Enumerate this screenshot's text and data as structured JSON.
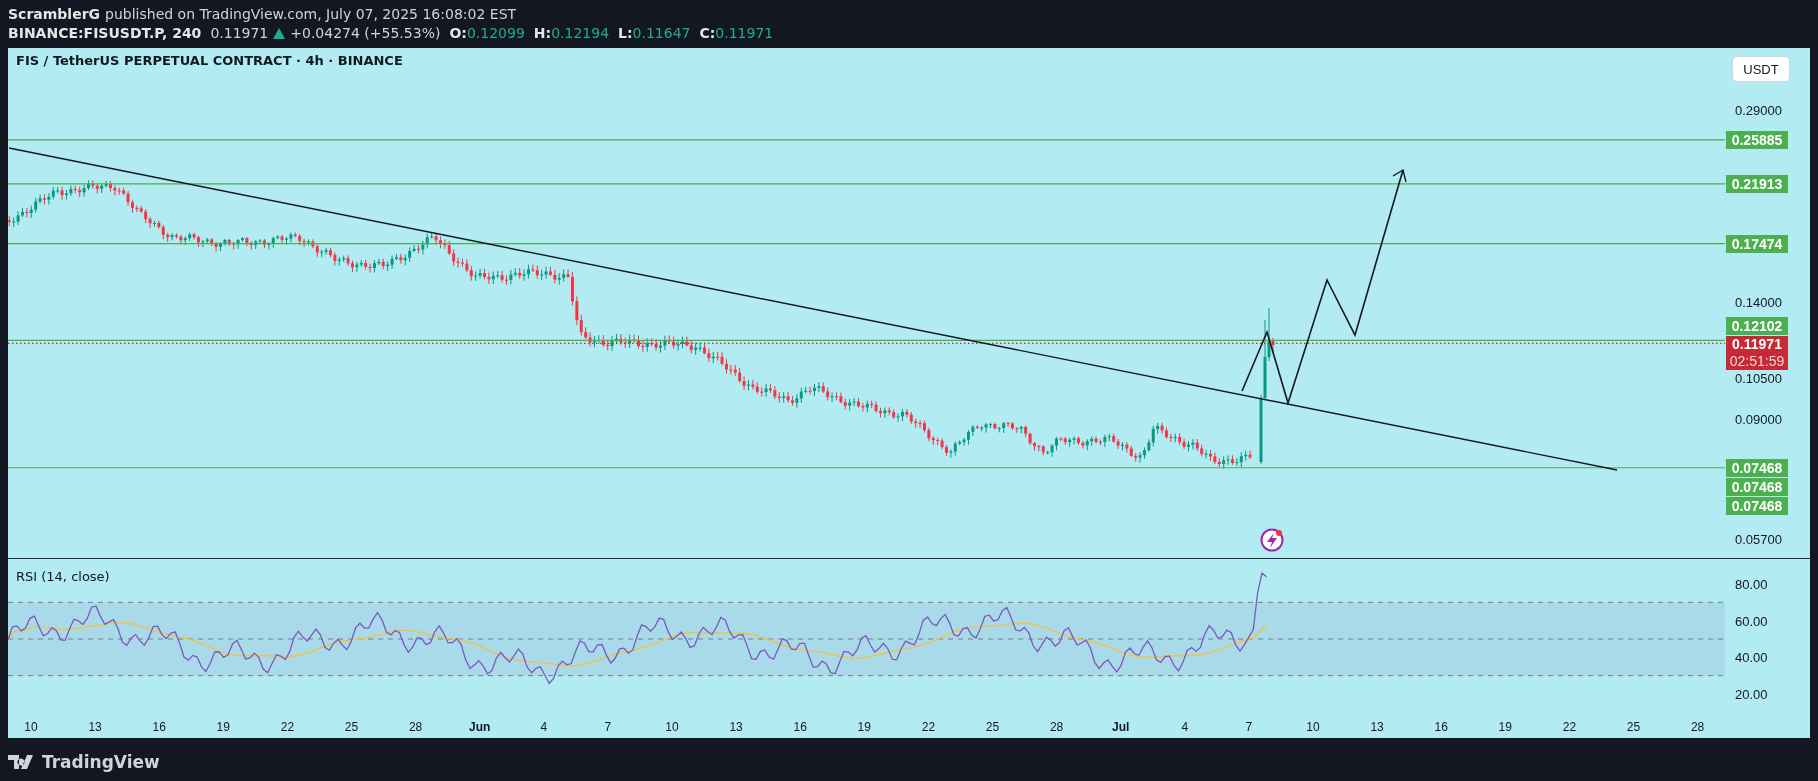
{
  "header": {
    "author": "ScramblerG",
    "published": "published on TradingView.com, July 07, 2025 16:08:02 EST"
  },
  "quote": {
    "symbol": "BINANCE:FISUSDT.P, 240",
    "last": "0.11971",
    "rising": true,
    "change": "+0.04274 (+55.53%)",
    "ohlc": [
      {
        "label": "O:",
        "value": "0.12099"
      },
      {
        "label": "H:",
        "value": "0.12194"
      },
      {
        "label": "L:",
        "value": "0.11647"
      },
      {
        "label": "C:",
        "value": "0.11971"
      }
    ]
  },
  "chart": {
    "title": "FIS / TetherUS PERPETUAL CONTRACT · 4h · BINANCE",
    "currency": "USDT",
    "price_ticks": [
      "0.29000",
      "0.14000",
      "0.10500",
      "0.09000",
      "0.05700"
    ],
    "levels": [
      {
        "price": "0.25885",
        "kind": "line"
      },
      {
        "price": "0.21913",
        "kind": "line"
      },
      {
        "price": "0.17474",
        "kind": "line"
      },
      {
        "price": "0.12102",
        "kind": "line"
      },
      {
        "price": "0.11971",
        "kind": "last",
        "countdown": "02:51:59"
      },
      {
        "price": "0.07468",
        "kind": "line"
      },
      {
        "price": "0.07468",
        "kind": "stack"
      },
      {
        "price": "0.07468",
        "kind": "stack"
      }
    ],
    "rsi": {
      "title": "RSI (14, close)",
      "ticks": [
        "80.00",
        "60.00",
        "40.00",
        "20.00"
      ]
    },
    "time_axis": [
      {
        "label": "10",
        "kind": "day"
      },
      {
        "label": "13",
        "kind": "day"
      },
      {
        "label": "16",
        "kind": "day"
      },
      {
        "label": "19",
        "kind": "day"
      },
      {
        "label": "22",
        "kind": "day"
      },
      {
        "label": "25",
        "kind": "day"
      },
      {
        "label": "28",
        "kind": "day"
      },
      {
        "label": "Jun",
        "kind": "month"
      },
      {
        "label": "4",
        "kind": "day"
      },
      {
        "label": "7",
        "kind": "day"
      },
      {
        "label": "10",
        "kind": "day"
      },
      {
        "label": "13",
        "kind": "day"
      },
      {
        "label": "16",
        "kind": "day"
      },
      {
        "label": "19",
        "kind": "day"
      },
      {
        "label": "22",
        "kind": "day"
      },
      {
        "label": "25",
        "kind": "day"
      },
      {
        "label": "28",
        "kind": "day"
      },
      {
        "label": "Jul",
        "kind": "month"
      },
      {
        "label": "4",
        "kind": "day"
      },
      {
        "label": "7",
        "kind": "day"
      },
      {
        "label": "10",
        "kind": "day"
      },
      {
        "label": "13",
        "kind": "day"
      },
      {
        "label": "16",
        "kind": "day"
      },
      {
        "label": "19",
        "kind": "day"
      },
      {
        "label": "22",
        "kind": "day"
      },
      {
        "label": "25",
        "kind": "day"
      },
      {
        "label": "28",
        "kind": "day"
      }
    ]
  },
  "footer": {
    "brand": "TradingView"
  }
}
